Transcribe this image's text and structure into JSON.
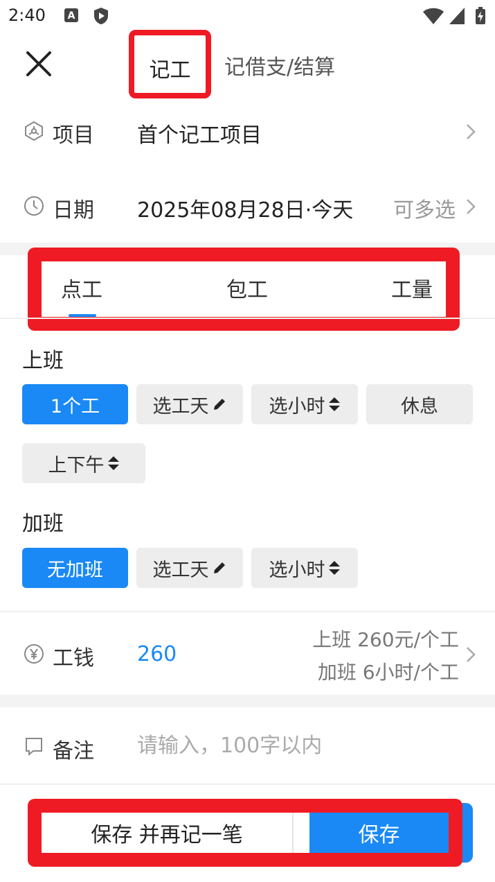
{
  "status_bar": {
    "time": "2:40"
  },
  "header": {
    "tab_record": "记工",
    "tab_loan": "记借支/结算"
  },
  "project": {
    "label": "项目",
    "value": "首个记工项目"
  },
  "date": {
    "label": "日期",
    "value": "2025年08月28日·今天",
    "hint": "可多选"
  },
  "type_tabs": [
    "点工",
    "包工",
    "工量"
  ],
  "work": {
    "title": "上班",
    "options": [
      "1个工",
      "选工天",
      "选小时",
      "休息",
      "上下午"
    ]
  },
  "overtime": {
    "title": "加班",
    "options": [
      "无加班",
      "选工天",
      "选小时"
    ]
  },
  "wage": {
    "label": "工钱",
    "value": "260",
    "hint_line1": "上班 260元/个工",
    "hint_line2": "加班 6小时/个工"
  },
  "notes": {
    "label": "备注",
    "placeholder": "请输入，100字以内"
  },
  "bottom": {
    "save_again": "保存 并再记一笔",
    "save": "保存"
  },
  "colors": {
    "accent": "#1a89f5",
    "highlight": "#ee1b24"
  }
}
